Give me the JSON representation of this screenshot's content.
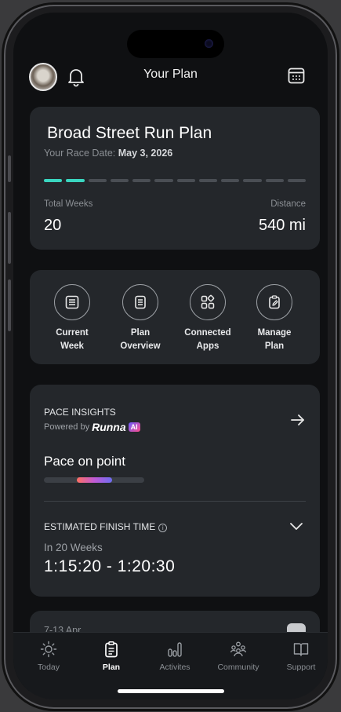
{
  "header": {
    "title": "Your Plan"
  },
  "plan": {
    "title": "Broad Street Run Plan",
    "race_date_label": "Your Race Date:",
    "race_date": "May 3, 2026",
    "progress_weeks_done": 2,
    "progress_weeks_total": 12,
    "total_weeks_label": "Total Weeks",
    "total_weeks_value": "20",
    "distance_label": "Distance",
    "distance_value": "540 mi",
    "accent_color": "#3ad6c0"
  },
  "actions": [
    {
      "line1": "Current",
      "line2": "Week",
      "icon": "list-icon"
    },
    {
      "line1": "Plan",
      "line2": "Overview",
      "icon": "document-icon"
    },
    {
      "line1": "Connected",
      "line2": "Apps",
      "icon": "apps-icon"
    },
    {
      "line1": "Manage",
      "line2": "Plan",
      "icon": "edit-clipboard-icon"
    }
  ],
  "insights": {
    "kicker": "PACE INSIGHTS",
    "powered_by": "Powered by",
    "brand": "Runna",
    "ai_badge": "AI",
    "pace_status": "Pace on point",
    "finish_label": "ESTIMATED FINISH TIME",
    "finish_info": "i",
    "finish_weeks": "In 20 Weeks",
    "finish_range": "1:15:20 - 1:20:30"
  },
  "week": {
    "label": "7-13 Apr"
  },
  "tabs": [
    {
      "label": "Today",
      "icon": "sun-icon",
      "active": false
    },
    {
      "label": "Plan",
      "icon": "clipboard-icon",
      "active": true
    },
    {
      "label": "Activites",
      "icon": "activity-bars-icon",
      "active": false
    },
    {
      "label": "Community",
      "icon": "community-icon",
      "active": false
    },
    {
      "label": "Support",
      "icon": "book-icon",
      "active": false
    }
  ]
}
